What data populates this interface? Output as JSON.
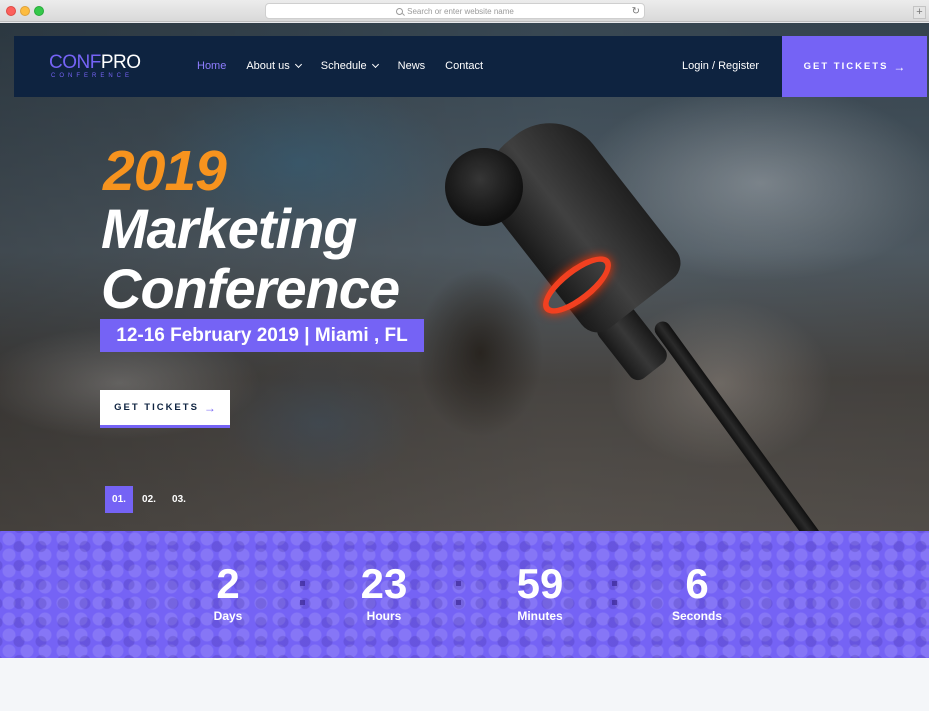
{
  "browser": {
    "url_placeholder": "Search or enter website name"
  },
  "navbar": {
    "logo_conf": "CONF",
    "logo_pro": "PRO",
    "logo_sub": "CONFERENCE",
    "items": [
      {
        "label": "Home",
        "active": true,
        "dropdown": false
      },
      {
        "label": "About us",
        "active": false,
        "dropdown": true
      },
      {
        "label": "Schedule",
        "active": false,
        "dropdown": true
      },
      {
        "label": "News",
        "active": false,
        "dropdown": false
      },
      {
        "label": "Contact",
        "active": false,
        "dropdown": false
      }
    ],
    "login": "Login / Register",
    "cta": "GET TICKETS"
  },
  "hero": {
    "year": "2019",
    "title_line1": "Marketing",
    "title_line2": "Conference",
    "date": "12-16 February 2019 | Miami , FL",
    "button": "GET TICKETS",
    "slides": [
      "01.",
      "02.",
      "03."
    ],
    "active_slide": 0
  },
  "countdown": [
    {
      "value": "2",
      "label": "Days"
    },
    {
      "value": "23",
      "label": "Hours"
    },
    {
      "value": "59",
      "label": "Minutes"
    },
    {
      "value": "6",
      "label": "Seconds"
    }
  ],
  "colors": {
    "accent": "#7563f5",
    "nav_bg": "#0e2340",
    "year": "#f7931e"
  }
}
